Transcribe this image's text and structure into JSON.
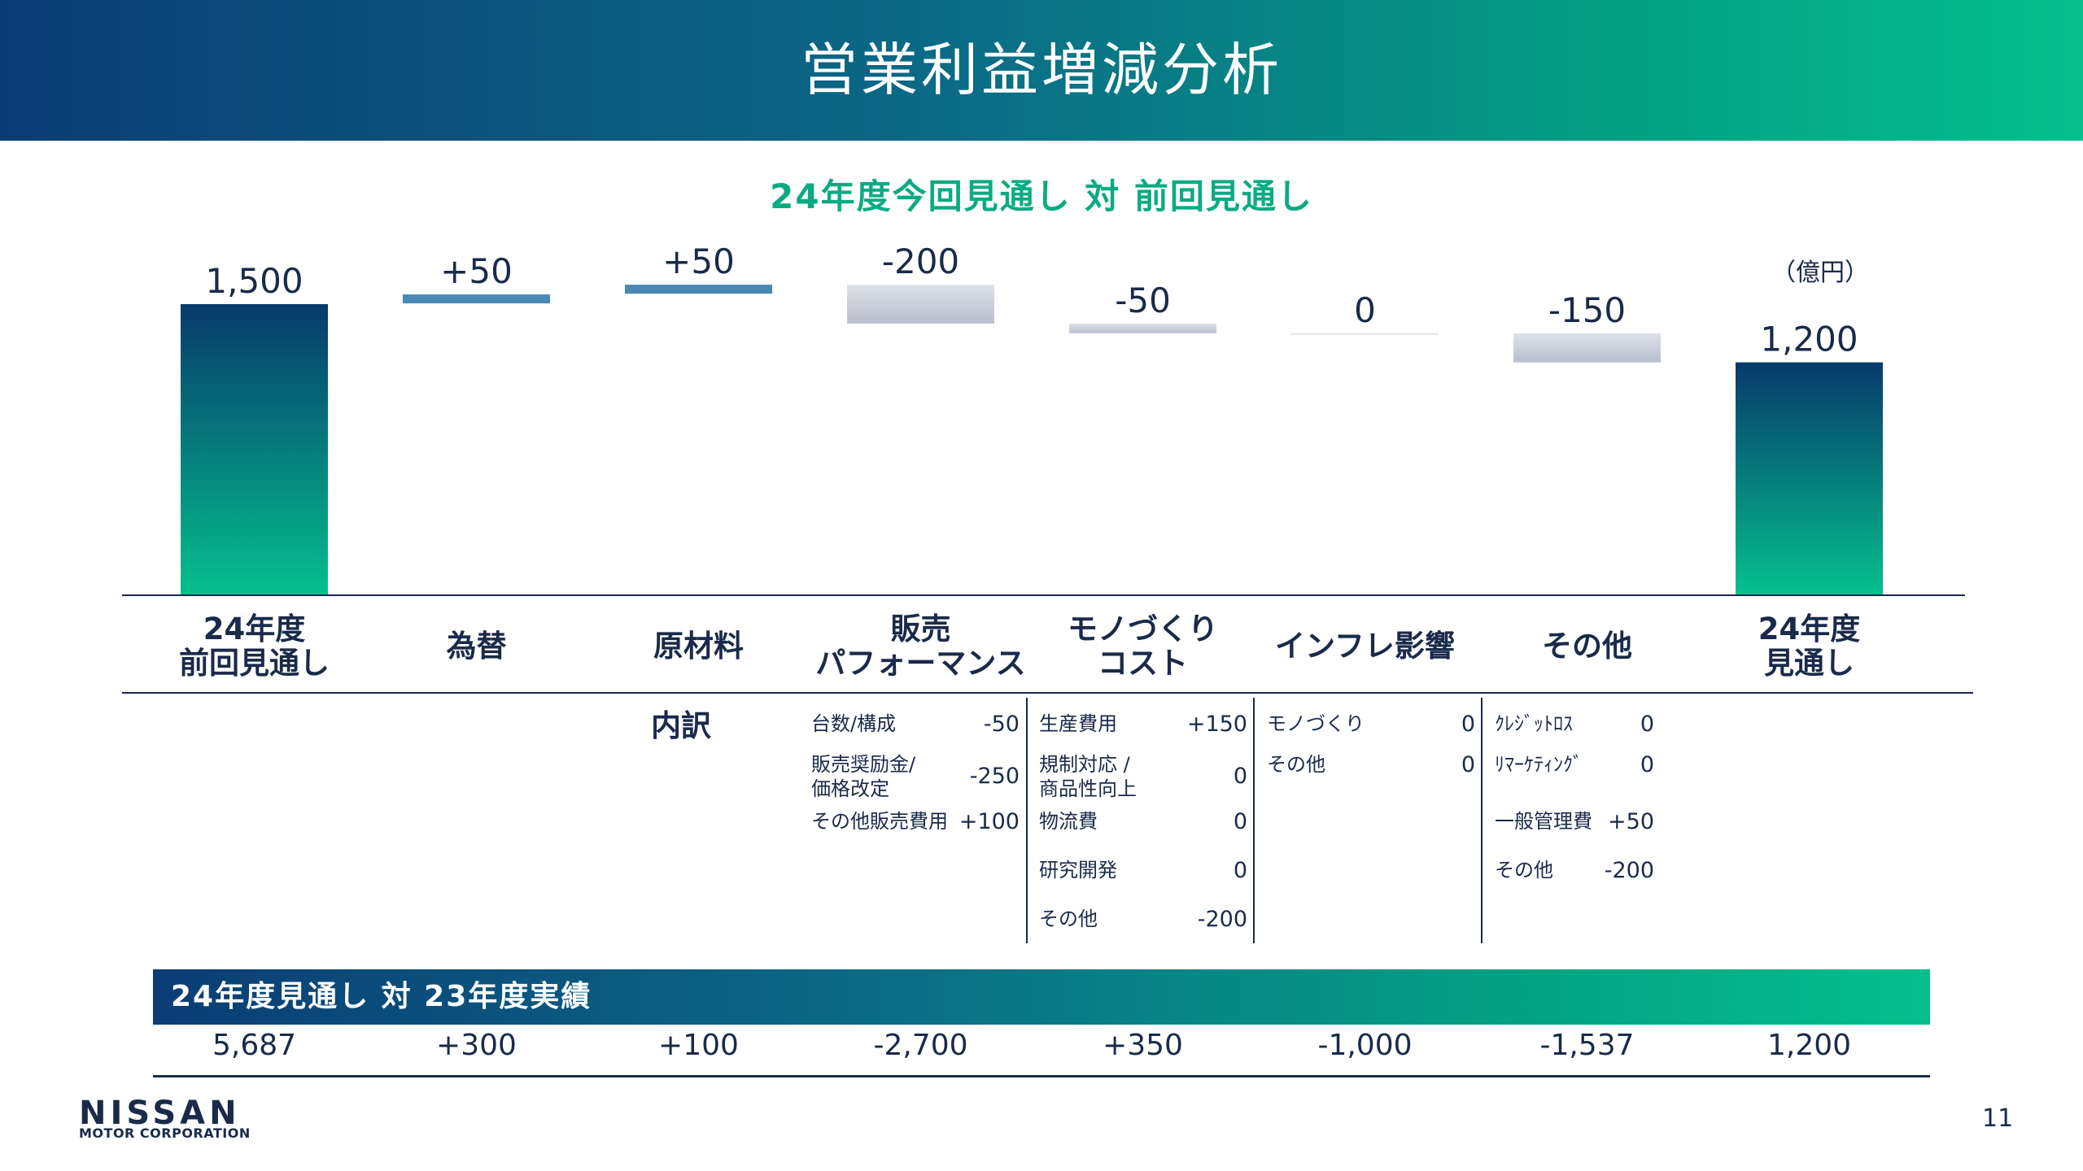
{
  "header": {
    "title": "営業利益増減分析"
  },
  "chart_data": {
    "type": "bar",
    "subtitle": "24年度今回見通し 対 前回見通し",
    "unit": "（億円）",
    "categories": [
      "24年度\n前回見通し",
      "為替",
      "原材料",
      "販売\nパフォーマンス",
      "モノづくり\nコスト",
      "インフレ影響",
      "その他",
      "24年度\n見通し"
    ],
    "values": [
      1500,
      50,
      50,
      -200,
      -50,
      0,
      -150,
      1200
    ],
    "labels": [
      "1,500",
      "+50",
      "+50",
      "-200",
      "-50",
      "0",
      "-150",
      "1,200"
    ],
    "measure": [
      "total",
      "relative",
      "relative",
      "relative",
      "relative",
      "relative",
      "relative",
      "total"
    ],
    "ylim": [
      0,
      1550
    ],
    "colors": {
      "total_top": "#083a6b",
      "total_bottom": "#05c08d",
      "increase": "#4a88b5",
      "decrease": "#c9ced8"
    }
  },
  "breakdown": {
    "title": "内訳",
    "columns": [
      [
        {
          "label": "台数/構成",
          "value": "-50"
        },
        {
          "label": "販売奨励金/\n価格改定",
          "value": "-250"
        },
        {
          "label": "その他販売費用",
          "value": "+100"
        }
      ],
      [
        {
          "label": "生産費用",
          "value": "+150"
        },
        {
          "label": "規制対応 /\n商品性向上",
          "value": "0"
        },
        {
          "label": "物流費",
          "value": "0"
        },
        {
          "label": "研究開発",
          "value": "0"
        },
        {
          "label": "その他",
          "value": "-200"
        }
      ],
      [
        {
          "label": "モノづくり",
          "value": "0"
        },
        {
          "label": "その他",
          "value": "0"
        }
      ],
      [
        {
          "label": "ｸﾚｼﾞｯﾄﾛｽ",
          "value": "0"
        },
        {
          "label": "ﾘﾏｰｹﾃｨﾝｸﾞ",
          "value": "0"
        },
        {
          "label": "一般管理費",
          "value": "+50"
        },
        {
          "label": "その他",
          "value": "-200"
        }
      ]
    ]
  },
  "comparison": {
    "title": "24年度見通し 対 23年度実績",
    "values": [
      "5,687",
      "+300",
      "+100",
      "-2,700",
      "+350",
      "-1,000",
      "-1,537",
      "1,200"
    ]
  },
  "footer": {
    "logo": "NISSAN",
    "logo_sub": "MOTOR CORPORATION",
    "page": "11"
  }
}
